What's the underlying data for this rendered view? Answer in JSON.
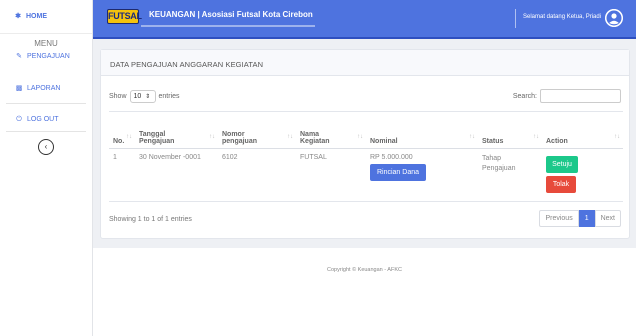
{
  "sidebar": {
    "home_label": "HOME",
    "heading": "MENU",
    "items": [
      {
        "label": "PENGAJUAN",
        "icon": "edit-icon"
      },
      {
        "label": "LAPORAN",
        "icon": "chart-icon"
      },
      {
        "label": "LOG OUT",
        "icon": "power-icon"
      }
    ],
    "toggle_icon": "chevron-left-icon"
  },
  "topbar": {
    "logo_text": "FUTSAL",
    "title": "KEUANGAN | Asosiasi Futsal Kota Cirebon",
    "welcome": "Selamat datang Ketua, Priadi"
  },
  "card": {
    "title": "DATA PENGAJUAN ANGGARAN KEGIATAN",
    "show_label": "Show",
    "entries_value": "10",
    "entries_label": "entries",
    "search_label": "Search:"
  },
  "table": {
    "headers": [
      "No.",
      "Tanggal Pengajuan",
      "Nomor pengajuan",
      "Nama Kegiatan",
      "Nominal",
      "Status",
      "Action"
    ],
    "rows": [
      {
        "no": "1",
        "tanggal": "30 November -0001",
        "nomor": "6102",
        "nama": "FUTSAL",
        "nominal": "RP 5.000.000",
        "rincian_label": "Rincian Dana",
        "status": "Tahap Pengajuan",
        "setuju_label": "Setuju",
        "tolak_label": "Tolak"
      }
    ],
    "info": "Showing 1 to 1 of 1 entries",
    "pagination": {
      "prev": "Previous",
      "current": "1",
      "next": "Next"
    }
  },
  "footer": {
    "copyright": "Copyright © Keuangan - AFKC"
  },
  "colors": {
    "primary": "#4e73df",
    "success": "#1cc88a",
    "danger": "#e74a3b",
    "logo": "#f4c20d"
  }
}
